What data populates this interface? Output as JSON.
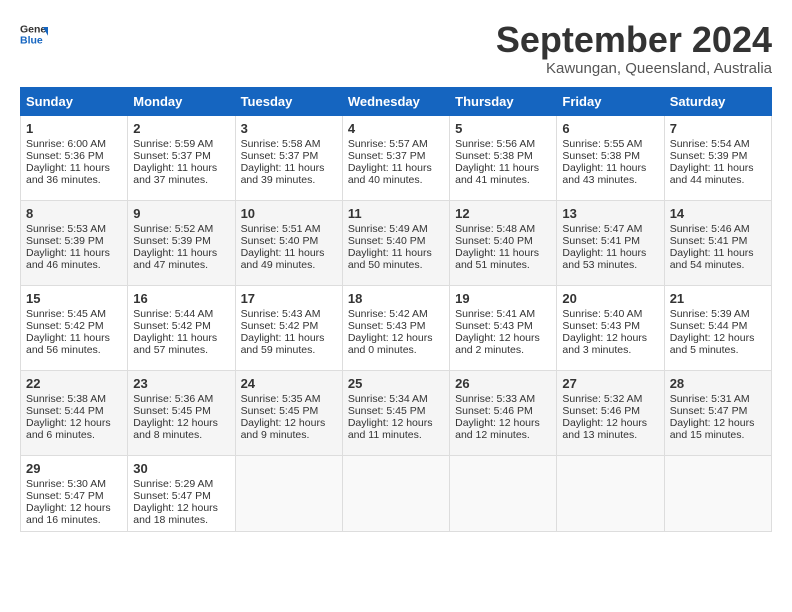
{
  "header": {
    "logo_line1": "General",
    "logo_line2": "Blue",
    "month": "September 2024",
    "location": "Kawungan, Queensland, Australia"
  },
  "days_of_week": [
    "Sunday",
    "Monday",
    "Tuesday",
    "Wednesday",
    "Thursday",
    "Friday",
    "Saturday"
  ],
  "weeks": [
    [
      {
        "day": "1",
        "info": "Sunrise: 6:00 AM\nSunset: 5:36 PM\nDaylight: 11 hours and 36 minutes."
      },
      {
        "day": "2",
        "info": "Sunrise: 5:59 AM\nSunset: 5:37 PM\nDaylight: 11 hours and 37 minutes."
      },
      {
        "day": "3",
        "info": "Sunrise: 5:58 AM\nSunset: 5:37 PM\nDaylight: 11 hours and 39 minutes."
      },
      {
        "day": "4",
        "info": "Sunrise: 5:57 AM\nSunset: 5:37 PM\nDaylight: 11 hours and 40 minutes."
      },
      {
        "day": "5",
        "info": "Sunrise: 5:56 AM\nSunset: 5:38 PM\nDaylight: 11 hours and 41 minutes."
      },
      {
        "day": "6",
        "info": "Sunrise: 5:55 AM\nSunset: 5:38 PM\nDaylight: 11 hours and 43 minutes."
      },
      {
        "day": "7",
        "info": "Sunrise: 5:54 AM\nSunset: 5:39 PM\nDaylight: 11 hours and 44 minutes."
      }
    ],
    [
      {
        "day": "8",
        "info": "Sunrise: 5:53 AM\nSunset: 5:39 PM\nDaylight: 11 hours and 46 minutes."
      },
      {
        "day": "9",
        "info": "Sunrise: 5:52 AM\nSunset: 5:39 PM\nDaylight: 11 hours and 47 minutes."
      },
      {
        "day": "10",
        "info": "Sunrise: 5:51 AM\nSunset: 5:40 PM\nDaylight: 11 hours and 49 minutes."
      },
      {
        "day": "11",
        "info": "Sunrise: 5:49 AM\nSunset: 5:40 PM\nDaylight: 11 hours and 50 minutes."
      },
      {
        "day": "12",
        "info": "Sunrise: 5:48 AM\nSunset: 5:40 PM\nDaylight: 11 hours and 51 minutes."
      },
      {
        "day": "13",
        "info": "Sunrise: 5:47 AM\nSunset: 5:41 PM\nDaylight: 11 hours and 53 minutes."
      },
      {
        "day": "14",
        "info": "Sunrise: 5:46 AM\nSunset: 5:41 PM\nDaylight: 11 hours and 54 minutes."
      }
    ],
    [
      {
        "day": "15",
        "info": "Sunrise: 5:45 AM\nSunset: 5:42 PM\nDaylight: 11 hours and 56 minutes."
      },
      {
        "day": "16",
        "info": "Sunrise: 5:44 AM\nSunset: 5:42 PM\nDaylight: 11 hours and 57 minutes."
      },
      {
        "day": "17",
        "info": "Sunrise: 5:43 AM\nSunset: 5:42 PM\nDaylight: 11 hours and 59 minutes."
      },
      {
        "day": "18",
        "info": "Sunrise: 5:42 AM\nSunset: 5:43 PM\nDaylight: 12 hours and 0 minutes."
      },
      {
        "day": "19",
        "info": "Sunrise: 5:41 AM\nSunset: 5:43 PM\nDaylight: 12 hours and 2 minutes."
      },
      {
        "day": "20",
        "info": "Sunrise: 5:40 AM\nSunset: 5:43 PM\nDaylight: 12 hours and 3 minutes."
      },
      {
        "day": "21",
        "info": "Sunrise: 5:39 AM\nSunset: 5:44 PM\nDaylight: 12 hours and 5 minutes."
      }
    ],
    [
      {
        "day": "22",
        "info": "Sunrise: 5:38 AM\nSunset: 5:44 PM\nDaylight: 12 hours and 6 minutes."
      },
      {
        "day": "23",
        "info": "Sunrise: 5:36 AM\nSunset: 5:45 PM\nDaylight: 12 hours and 8 minutes."
      },
      {
        "day": "24",
        "info": "Sunrise: 5:35 AM\nSunset: 5:45 PM\nDaylight: 12 hours and 9 minutes."
      },
      {
        "day": "25",
        "info": "Sunrise: 5:34 AM\nSunset: 5:45 PM\nDaylight: 12 hours and 11 minutes."
      },
      {
        "day": "26",
        "info": "Sunrise: 5:33 AM\nSunset: 5:46 PM\nDaylight: 12 hours and 12 minutes."
      },
      {
        "day": "27",
        "info": "Sunrise: 5:32 AM\nSunset: 5:46 PM\nDaylight: 12 hours and 13 minutes."
      },
      {
        "day": "28",
        "info": "Sunrise: 5:31 AM\nSunset: 5:47 PM\nDaylight: 12 hours and 15 minutes."
      }
    ],
    [
      {
        "day": "29",
        "info": "Sunrise: 5:30 AM\nSunset: 5:47 PM\nDaylight: 12 hours and 16 minutes."
      },
      {
        "day": "30",
        "info": "Sunrise: 5:29 AM\nSunset: 5:47 PM\nDaylight: 12 hours and 18 minutes."
      },
      {
        "day": "",
        "info": ""
      },
      {
        "day": "",
        "info": ""
      },
      {
        "day": "",
        "info": ""
      },
      {
        "day": "",
        "info": ""
      },
      {
        "day": "",
        "info": ""
      }
    ]
  ]
}
